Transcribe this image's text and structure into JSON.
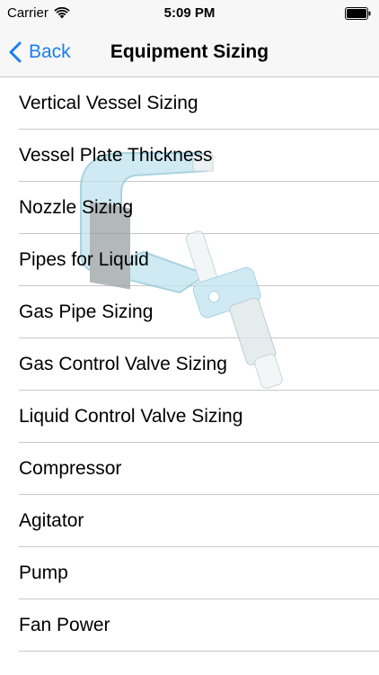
{
  "status_bar": {
    "carrier": "Carrier",
    "time": "5:09 PM",
    "wifi_icon": "wifi-icon",
    "battery_icon": "battery-icon"
  },
  "nav": {
    "back_label": "Back",
    "back_icon": "chevron-left-icon",
    "title": "Equipment Sizing",
    "accent_color": "#1a7ff0"
  },
  "items": [
    {
      "label": "Vertical Vessel Sizing"
    },
    {
      "label": "Vessel Plate Thickness"
    },
    {
      "label": "Nozzle Sizing"
    },
    {
      "label": "Pipes for Liquid"
    },
    {
      "label": "Gas Pipe Sizing"
    },
    {
      "label": "Gas Control Valve Sizing"
    },
    {
      "label": "Liquid Control Valve Sizing"
    },
    {
      "label": "Compressor"
    },
    {
      "label": "Agitator"
    },
    {
      "label": "Pump"
    },
    {
      "label": "Fan Power"
    }
  ],
  "watermark_icon": "micrometer-icon"
}
